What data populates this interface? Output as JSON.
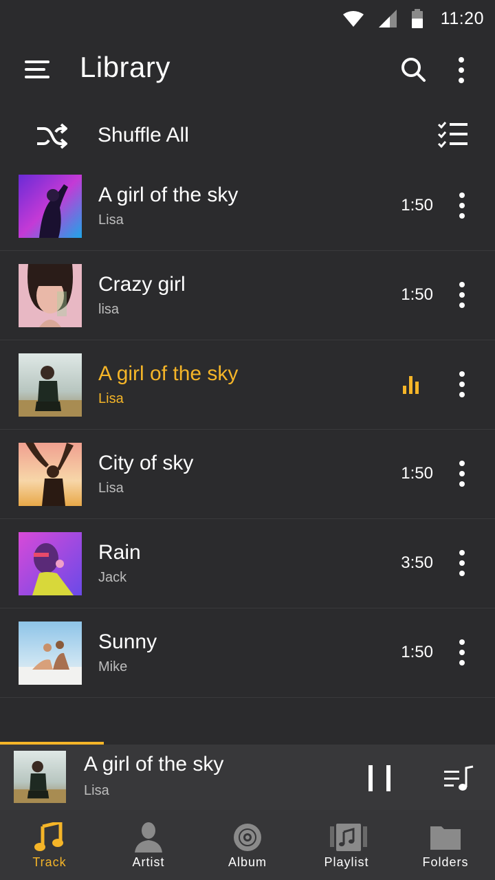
{
  "status_bar": {
    "time": "11:20",
    "icons": [
      "wifi-icon",
      "cellular-signal-icon",
      "battery-icon"
    ]
  },
  "app_bar": {
    "title": "Library",
    "icons": [
      "menu-icon",
      "search-icon",
      "more-vertical-icon"
    ]
  },
  "shuffle": {
    "label": "Shuffle All",
    "icons": [
      "shuffle-icon",
      "checklist-icon"
    ]
  },
  "tracks": [
    {
      "title": "A girl of the sky",
      "artist": "Lisa",
      "duration": "1:50",
      "playing": false
    },
    {
      "title": "Crazy girl",
      "artist": "lisa",
      "duration": "1:50",
      "playing": false
    },
    {
      "title": "A girl of the sky",
      "artist": "Lisa",
      "duration": "",
      "playing": true
    },
    {
      "title": "City of sky",
      "artist": "Lisa",
      "duration": "1:50",
      "playing": false
    },
    {
      "title": "Rain",
      "artist": "Jack",
      "duration": "3:50",
      "playing": false
    },
    {
      "title": "Sunny",
      "artist": "Mike",
      "duration": "1:50",
      "playing": false
    }
  ],
  "now_playing": {
    "title": "A girl of the sky",
    "artist": "Lisa",
    "progress": 0.21,
    "icons": [
      "pause-icon",
      "queue-music-icon"
    ]
  },
  "bottom_nav": {
    "items": [
      {
        "label": "Track",
        "icon": "music-note-icon",
        "active": true
      },
      {
        "label": "Artist",
        "icon": "person-icon",
        "active": false
      },
      {
        "label": "Album",
        "icon": "disc-icon",
        "active": false
      },
      {
        "label": "Playlist",
        "icon": "playlist-icon",
        "active": false
      },
      {
        "label": "Folders",
        "icon": "folder-icon",
        "active": false
      }
    ]
  },
  "colors": {
    "background": "#2b2b2d",
    "accent": "#f5b528",
    "mini_player": "#38383a",
    "nav_bar": "#363638",
    "secondary_text": "#bdbdbd"
  }
}
